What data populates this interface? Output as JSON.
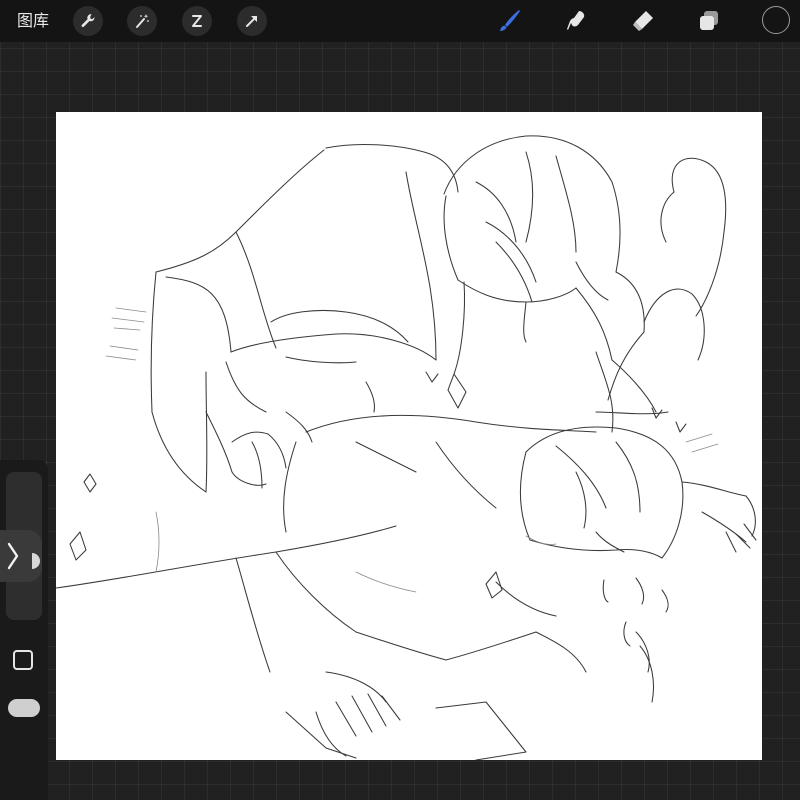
{
  "toolbar": {
    "gallery_label": "图库",
    "left_tools": [
      {
        "name": "actions",
        "icon": "wrench-icon"
      },
      {
        "name": "adjustments",
        "icon": "magic-wand-icon"
      },
      {
        "name": "selection",
        "icon": "selection-s-icon"
      },
      {
        "name": "transform",
        "icon": "arrow-cursor-icon"
      }
    ],
    "right_tools": [
      {
        "name": "brush",
        "icon": "brush-icon",
        "active": true
      },
      {
        "name": "smudge",
        "icon": "smudge-finger-icon",
        "active": false
      },
      {
        "name": "eraser",
        "icon": "eraser-icon",
        "active": false
      },
      {
        "name": "layers",
        "icon": "layers-icon",
        "active": false
      }
    ],
    "color_swatch": "#141414"
  },
  "colors": {
    "accent": "#3b6fe0",
    "toolbar_bg": "#141414",
    "workspace_bg": "#212121",
    "canvas_bg": "#ffffff"
  },
  "sidebar": {
    "expand_icon": "chevron-right-icon",
    "modify_icon": "square-outline-icon"
  }
}
